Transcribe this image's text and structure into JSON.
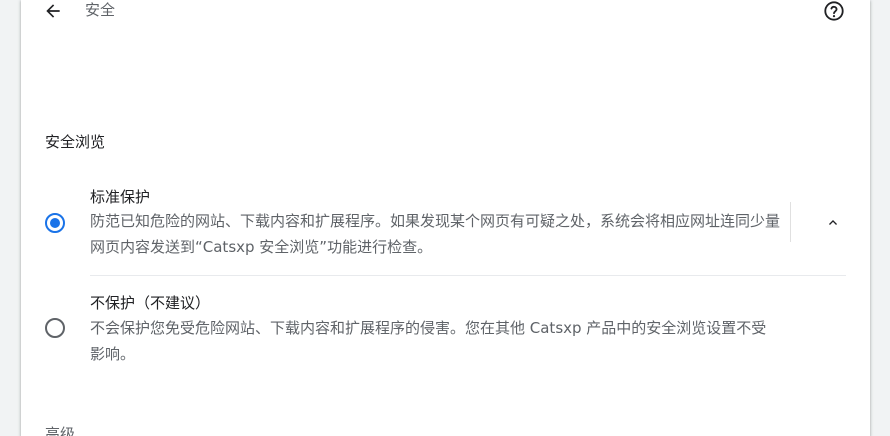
{
  "header": {
    "back_icon": "arrow-back-icon",
    "title": "安全",
    "help_icon": "help-circle-icon"
  },
  "safe_browsing": {
    "section_title": "安全浏览",
    "options": [
      {
        "label": "标准保护",
        "description": "防范已知危险的网站、下载内容和扩展程序。如果发现某个网页有可疑之处，系统会将相应网址连同少量网页内容发送到“Catsxp 安全浏览”功能进行检查。",
        "selected": true,
        "expanded": true
      },
      {
        "label": "不保护（不建议）",
        "description": "不会保护您免受危险网站、下载内容和扩展程序的侵害。您在其他 Catsxp 产品中的安全浏览设置不受影响。",
        "selected": false
      }
    ],
    "expand_icon": "chevron-up-icon"
  },
  "advanced": {
    "section_title": "高级"
  },
  "colors": {
    "accent": "#1a73e8",
    "text_primary": "#202124",
    "text_secondary": "#5f6368",
    "background": "#f1f3f4",
    "card": "#ffffff"
  }
}
